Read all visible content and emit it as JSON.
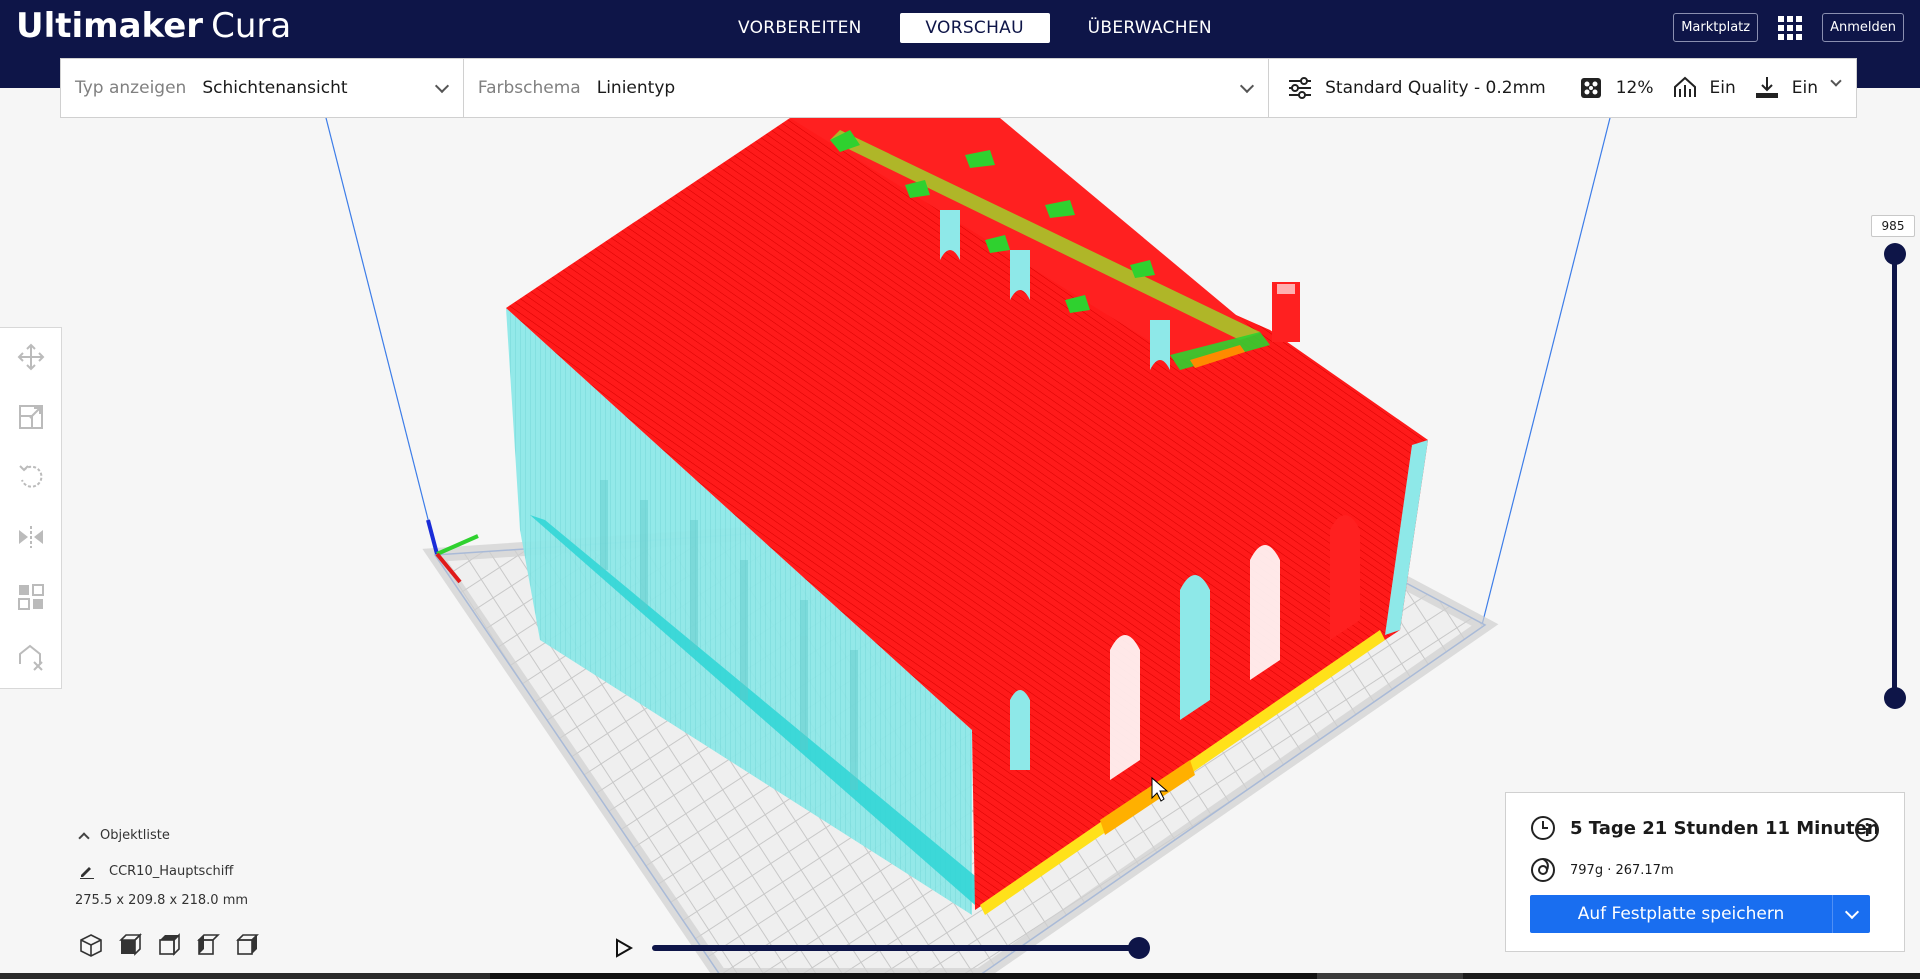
{
  "app": {
    "brand_bold": "Ultimaker",
    "brand_light": "Cura"
  },
  "stages": [
    {
      "label": "VORBEREITEN",
      "active": false
    },
    {
      "label": "VORSCHAU",
      "active": true
    },
    {
      "label": "ÜBERWACHEN",
      "active": false
    }
  ],
  "header": {
    "marketplace_label": "Marktplatz",
    "signin_label": "Anmelden"
  },
  "toolbar": {
    "view_type_label": "Typ anzeigen",
    "view_type_value": "Schichtenansicht",
    "color_scheme_label": "Farbschema",
    "color_scheme_value": "Linientyp",
    "profile": "Standard Quality - 0.2mm",
    "infill": "12%",
    "support": "Ein",
    "adhesion": "Ein"
  },
  "layer_slider": {
    "value": "985"
  },
  "object_list": {
    "title": "Objektliste",
    "item_name": "CCR10_Hauptschiff",
    "dimensions": "275.5 x 209.8 x 218.0 mm"
  },
  "summary": {
    "print_time": "5 Tage 21 Stunden 11 Minuten",
    "material": "797g · 267.17m",
    "save_label": "Auf Festplatte speichern"
  },
  "colors": {
    "header_bg": "#0e1548",
    "accent_blue": "#196ef0",
    "wall_outer": "#ff1a1a",
    "wall_inner": "#7fe6e6",
    "infill_yellow": "#ffe11a",
    "skin_green": "#2fd12f"
  }
}
